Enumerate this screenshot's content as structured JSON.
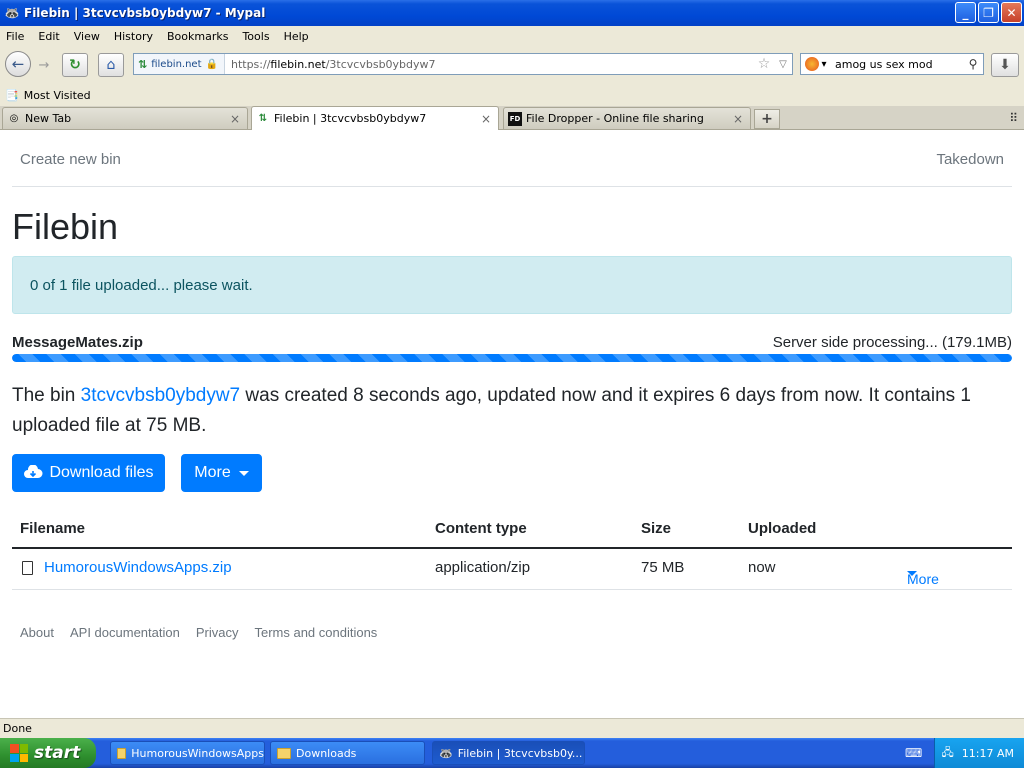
{
  "window": {
    "title": "Filebin | 3tcvcvbsb0ybdyw7 - Mypal",
    "min": "_",
    "max": "❐",
    "close": "✕"
  },
  "menu": [
    "File",
    "Edit",
    "View",
    "History",
    "Bookmarks",
    "Tools",
    "Help"
  ],
  "nav": {
    "site_identity": "filebin.net",
    "url_prefix": "https://",
    "url_host": "filebin.net",
    "url_path": "/3tcvcvbsb0ybdyw7",
    "search_value": "amog us sex mod"
  },
  "bookmarks": {
    "most_visited": "Most Visited"
  },
  "tabs": [
    {
      "label": "New Tab"
    },
    {
      "label": "Filebin | 3tcvcvbsb0ybdyw7"
    },
    {
      "label": "File Dropper - Online file sharing",
      "icon_text": "FD"
    }
  ],
  "page": {
    "create_new_bin": "Create new bin",
    "takedown": "Takedown",
    "title": "Filebin",
    "alert": "0 of 1 file uploaded... please wait.",
    "upload": {
      "filename": "MessageMates.zip",
      "status": "Server side processing... (179.1MB)",
      "progress_percent": 100
    },
    "info": {
      "prefix": "The bin ",
      "bin_id": "3tcvcvbsb0ybdyw7",
      "suffix": " was created 8 seconds ago, updated now and it expires 6 days from now. It contains 1 uploaded file at 75 MB."
    },
    "download_files": "Download files",
    "more": "More",
    "table": {
      "headers": {
        "filename": "Filename",
        "content_type": "Content type",
        "size": "Size",
        "uploaded": "Uploaded"
      },
      "rows": [
        {
          "filename": "HumorousWindowsApps.zip",
          "content_type": "application/zip",
          "size": "75 MB",
          "uploaded": "now",
          "more": "More"
        }
      ]
    },
    "footer": [
      "About",
      "API documentation",
      "Privacy",
      "Terms and conditions"
    ]
  },
  "status_bar": "Done",
  "taskbar": {
    "start": "start",
    "tasks": [
      {
        "label": "HumorousWindowsApps"
      },
      {
        "label": "Downloads"
      },
      {
        "label": "Filebin | 3tcvcvbsb0y..."
      }
    ],
    "clock": "11:17 AM"
  },
  "colors": {
    "link": "#007bff",
    "alert_bg": "#d1ecf1",
    "xp_blue": "#245edc"
  }
}
